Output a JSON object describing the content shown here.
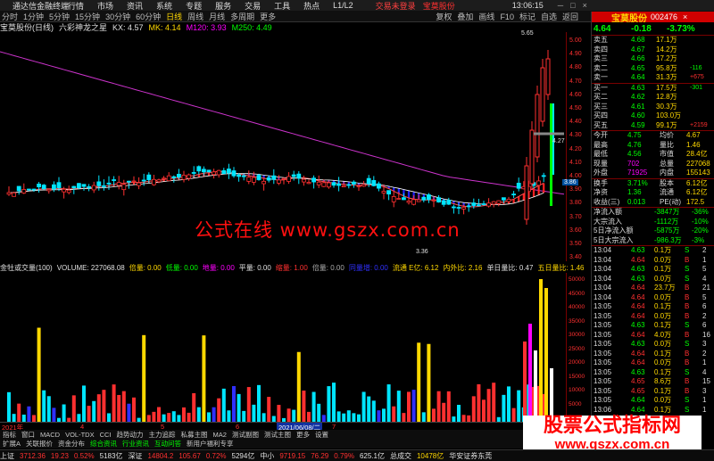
{
  "app": {
    "title": "通达信金融终端",
    "menu": [
      "行情",
      "市场",
      "资讯",
      "系统",
      "专题",
      "服务",
      "交易",
      "工具",
      "热点",
      "L1/L2"
    ],
    "login_warning": "交易未登录",
    "stock_tag": "宝莫股份",
    "window_buttons": [
      "─",
      "□",
      "×"
    ]
  },
  "toolbar": {
    "periods": [
      "分时",
      "1分钟",
      "5分钟",
      "15分钟",
      "30分钟",
      "60分钟",
      "日线",
      "周线",
      "月线",
      "多周期",
      "更多"
    ],
    "selected": "日线",
    "right_tools": [
      "复权",
      "叠加",
      "画线",
      "F10",
      "标记",
      "自选",
      "返回"
    ]
  },
  "chart_header": {
    "stock_name": "宝莫股份(日线)",
    "indicator_name": "六彩神龙之星",
    "kx": "KX: 4.57",
    "mk": "MK: 4.14",
    "m120": "M120: 3.93",
    "m250": "M250: 4.49"
  },
  "price_axis": [
    "5.00",
    "4.90",
    "4.80",
    "4.70",
    "4.60",
    "4.50",
    "4.40",
    "4.30",
    "4.20",
    "4.10",
    "4.00",
    "3.90",
    "3.80",
    "3.70",
    "3.60",
    "3.50",
    "3.40"
  ],
  "annotations": {
    "high": "5.65",
    "low": "3.36",
    "current": "4.27",
    "price_tag": "3.86"
  },
  "watermark": {
    "center": "公式在线   www.gszx.com.cn",
    "corner_l1": "股票公式指标网",
    "corner_l2": "www.gszx.com.cn"
  },
  "volume_header": {
    "title": "金牡或交量(100)",
    "volume": "VOLUME: 227068.08",
    "items": [
      {
        "t": "倍量: 0.00",
        "c": "#ffd800"
      },
      {
        "t": "低量: 0.00",
        "c": "#00ff00"
      },
      {
        "t": "地量: 0.00",
        "c": "#ff00ff"
      },
      {
        "t": "平量: 0.00",
        "c": "#e0e0e0"
      },
      {
        "t": "缩量: 1.00",
        "c": "#ff3030"
      },
      {
        "t": "倍量: 0.00",
        "c": "#aaaaaa"
      },
      {
        "t": "同量增: 0.00",
        "c": "#3030ff"
      },
      {
        "t": "流通 E亿: 6.12",
        "c": "#ffd800"
      },
      {
        "t": "内外比: 2.16",
        "c": "#ffd800"
      },
      {
        "t": "单日量比: 0.47",
        "c": "#e0e0e0"
      },
      {
        "t": "五日量比: 1.46",
        "c": "#ffd800"
      }
    ]
  },
  "volume_axis": [
    "50000",
    "45000",
    "40000",
    "35000",
    "30000",
    "25000",
    "20000",
    "15000",
    "10000",
    "5000",
    "0"
  ],
  "date_bar": {
    "year": "2021年",
    "m4": "4",
    "m5": "5",
    "m6": "6",
    "selected_date": "2021/06/08/二",
    "m7": "7"
  },
  "tabs1": [
    "指标",
    "窗口",
    "MACD",
    "VOL-TDX",
    "CCI",
    "趋势动力",
    "主力追踪",
    "私募主图",
    "MA2",
    "测试副图",
    "测试主图",
    "更多",
    "设置"
  ],
  "tabs2": [
    "扩展A",
    "关联报价",
    "资金分布",
    "综合资讯",
    "行业资讯",
    "互动问答",
    "新用户福利专享"
  ],
  "tabs2_highlight": [
    "综合资讯",
    "行业资讯",
    "互动问答"
  ],
  "quote": {
    "name": "宝莫股份",
    "code": "002476",
    "price": "4.64",
    "change": "-0.18",
    "pct": "-3.73%",
    "asks": [
      {
        "label": "卖五",
        "price": "4.68",
        "vol": "17.1万",
        "chg": ""
      },
      {
        "label": "卖四",
        "price": "4.67",
        "vol": "14.2万",
        "chg": ""
      },
      {
        "label": "卖三",
        "price": "4.66",
        "vol": "17.2万",
        "chg": ""
      },
      {
        "label": "卖二",
        "price": "4.65",
        "vol": "95.8万",
        "chg": "-116"
      },
      {
        "label": "卖一",
        "price": "4.64",
        "vol": "31.3万",
        "chg": "+675"
      }
    ],
    "bids": [
      {
        "label": "买一",
        "price": "4.63",
        "vol": "17.5万",
        "chg": "-301"
      },
      {
        "label": "买二",
        "price": "4.62",
        "vol": "12.8万",
        "chg": ""
      },
      {
        "label": "买三",
        "price": "4.61",
        "vol": "30.3万",
        "chg": ""
      },
      {
        "label": "买四",
        "price": "4.60",
        "vol": "103.0万",
        "chg": ""
      },
      {
        "label": "买五",
        "price": "4.59",
        "vol": "99.1万",
        "chg": "+2159"
      }
    ],
    "stats": [
      {
        "l1": "今开",
        "v1": "4.75",
        "l2": "均价",
        "v2": "4.67"
      },
      {
        "l1": "最高",
        "v1": "4.76",
        "l2": "量比",
        "v2": "1.46"
      },
      {
        "l1": "最低",
        "v1": "4.56",
        "l2": "市值",
        "v2": "28.4亿"
      },
      {
        "l1": "现量",
        "v1": "702",
        "l2": "总量",
        "v2": "227068"
      },
      {
        "l1": "外盘",
        "v1": "71925",
        "l2": "内盘",
        "v2": "155143"
      },
      {
        "l1": "换手",
        "v1": "3.71%",
        "l2": "股本",
        "v2": "6.12亿"
      },
      {
        "l1": "净资",
        "v1": "1.36",
        "l2": "流通",
        "v2": "6.12亿"
      },
      {
        "l1": "收益(三)",
        "v1": "0.013",
        "l2": "PE(动)",
        "v2": "172.5"
      }
    ],
    "flows": [
      {
        "label": "净流入额",
        "val": "-3847万",
        "pct": "-36%"
      },
      {
        "label": "大宗流入",
        "val": "-1112万",
        "pct": "-10%"
      },
      {
        "label": "5日净流入额",
        "val": "-5875万",
        "pct": "-20%"
      },
      {
        "label": "5日大宗流入",
        "val": "-986.3万",
        "pct": "-3%"
      }
    ],
    "ticks": [
      {
        "t": "13:04",
        "p": "4.63",
        "v": "0.1万",
        "f": "S",
        "n": "2"
      },
      {
        "t": "13:04",
        "p": "4.64",
        "v": "0.0万",
        "f": "B",
        "n": "1"
      },
      {
        "t": "13:04",
        "p": "4.63",
        "v": "0.1万",
        "f": "S",
        "n": "5"
      },
      {
        "t": "13:04",
        "p": "4.63",
        "v": "0.0万",
        "f": "S",
        "n": "4"
      },
      {
        "t": "13:04",
        "p": "4.64",
        "v": "23.7万",
        "f": "B",
        "n": "21"
      },
      {
        "t": "13:04",
        "p": "4.64",
        "v": "0.0万",
        "f": "B",
        "n": "5"
      },
      {
        "t": "13:05",
        "p": "4.64",
        "v": "0.1万",
        "f": "B",
        "n": "6"
      },
      {
        "t": "13:05",
        "p": "4.64",
        "v": "0.0万",
        "f": "B",
        "n": "2"
      },
      {
        "t": "13:05",
        "p": "4.63",
        "v": "0.1万",
        "f": "S",
        "n": "6"
      },
      {
        "t": "13:05",
        "p": "4.64",
        "v": "4.0万",
        "f": "B",
        "n": "16"
      },
      {
        "t": "13:05",
        "p": "4.63",
        "v": "0.0万",
        "f": "S",
        "n": "3"
      },
      {
        "t": "13:05",
        "p": "4.64",
        "v": "0.1万",
        "f": "B",
        "n": "2"
      },
      {
        "t": "13:05",
        "p": "4.64",
        "v": "0.0万",
        "f": "B",
        "n": "1"
      },
      {
        "t": "13:05",
        "p": "4.63",
        "v": "0.1万",
        "f": "S",
        "n": "4"
      },
      {
        "t": "13:05",
        "p": "4.65",
        "v": "8.6万",
        "f": "B",
        "n": "15"
      },
      {
        "t": "13:05",
        "p": "4.65",
        "v": "0.1万",
        "f": "B",
        "n": "3"
      },
      {
        "t": "13:05",
        "p": "4.64",
        "v": "0.0万",
        "f": "S",
        "n": "1"
      },
      {
        "t": "13:06",
        "p": "4.64",
        "v": "0.1万",
        "f": "S",
        "n": "1"
      }
    ]
  },
  "ticker": [
    {
      "t": "上证",
      "c": "#e0e0e0"
    },
    {
      "t": "3712.36",
      "c": "#ff3030"
    },
    {
      "t": "19.23",
      "c": "#ff3030"
    },
    {
      "t": "0.52%",
      "c": "#ff3030"
    },
    {
      "t": "5183亿",
      "c": "#e0e0e0"
    },
    {
      "t": "深证",
      "c": "#e0e0e0"
    },
    {
      "t": "14804.2",
      "c": "#ff3030"
    },
    {
      "t": "105.67",
      "c": "#ff3030"
    },
    {
      "t": "0.72%",
      "c": "#ff3030"
    },
    {
      "t": "5294亿",
      "c": "#e0e0e0"
    },
    {
      "t": "中小",
      "c": "#e0e0e0"
    },
    {
      "t": "9719.15",
      "c": "#ff3030"
    },
    {
      "t": "76.29",
      "c": "#ff3030"
    },
    {
      "t": "0.79%",
      "c": "#ff3030"
    },
    {
      "t": "625.1亿",
      "c": "#e0e0e0"
    },
    {
      "t": "总成交",
      "c": "#e0e0e0"
    },
    {
      "t": "10478亿",
      "c": "#ffd800"
    },
    {
      "t": "华安证券东莞",
      "c": "#e0e0e0"
    }
  ],
  "clock": "13:06:15",
  "chart_data": {
    "type": "candlestick",
    "ylim": [
      3.3,
      5.1
    ],
    "vol_ylim": [
      0,
      55000
    ],
    "series": []
  }
}
